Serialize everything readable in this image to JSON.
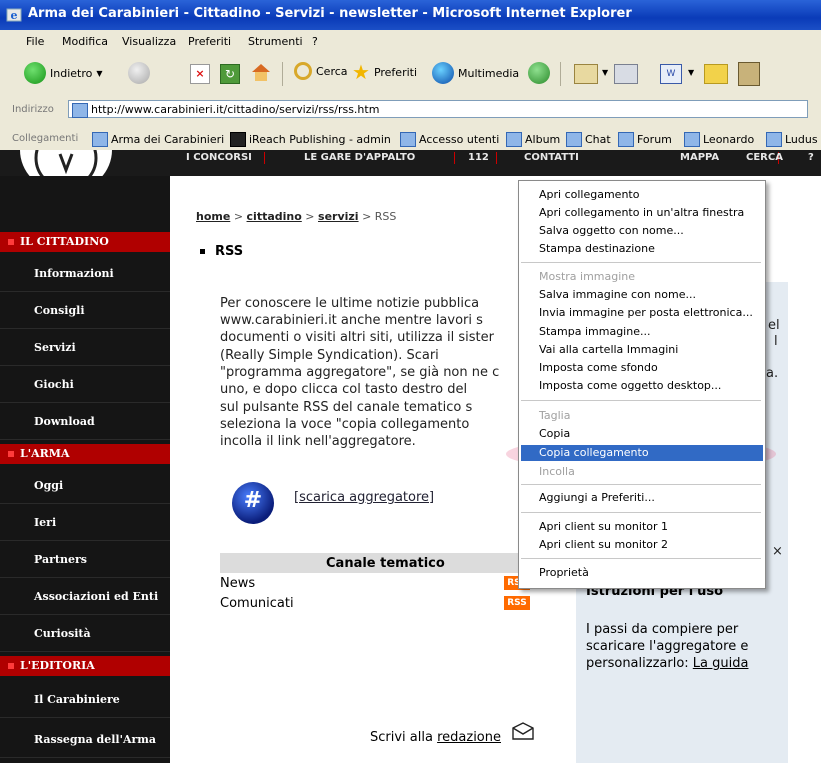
{
  "window": {
    "title": "Arma dei Carabinieri - Cittadino - Servizi - newsletter - Microsoft Internet Explorer"
  },
  "menubar": {
    "items": [
      "File",
      "Modifica",
      "Visualizza",
      "Preferiti",
      "Strumenti",
      "?"
    ]
  },
  "toolbar": {
    "back": "Indietro",
    "search": "Cerca",
    "favorites": "Preferiti",
    "media": "Multimedia"
  },
  "address": {
    "label": "Indirizzo",
    "url": "http://www.carabinieri.it/cittadino/servizi/rss/rss.htm"
  },
  "links": {
    "label": "Collegamenti",
    "items": [
      "Arma dei Carabinieri",
      "iReach Publishing - admin",
      "Accesso utenti",
      "Album",
      "Chat",
      "Forum",
      "Leonardo",
      "Ludus"
    ]
  },
  "topnav": {
    "items": [
      "I CONCORSI",
      "LE GARE D'APPALTO",
      "112",
      "CONTATTI",
      "MAPPA",
      "CERCA",
      "?"
    ]
  },
  "sidebar": {
    "sections": [
      "IL CITTADINO",
      "L'ARMA",
      "L'EDITORIA"
    ],
    "cittadino": [
      "Informazioni",
      "Consigli",
      "Servizi",
      "Giochi",
      "Download"
    ],
    "arma": [
      "Oggi",
      "Ieri",
      "Partners",
      "Associazioni ed Enti",
      "Curiosità"
    ],
    "editoria": [
      "Il Carabiniere",
      "Rassegna dell'Arma"
    ]
  },
  "breadcrumb": {
    "home": "home",
    "sep": ">",
    "cittadino": "cittadino",
    "servizi": "servizi",
    "current": "RSS"
  },
  "content": {
    "heading": "RSS",
    "lines": [
      "Per conoscere le ultime notizie pubblica",
      "www.carabinieri.it anche mentre lavori s",
      "documenti o visiti altri siti, utilizza il sister",
      "(Really    Simple    Syndication).    Scari",
      "\"programma aggregatore\", se già non ne c",
      "uno, e dopo clicca col tasto destro del",
      "sul pulsante RSS del canale tematico s",
      "seleziona  la  voce  \"copia  collegamento",
      "incolla il link nell'aggregatore."
    ],
    "aggregator_link": "[scarica aggregatore]",
    "table_header": "Canale tematico",
    "rows": [
      "News",
      "Comunicati"
    ],
    "rss_badge": "RSS",
    "partial_right": [
      "el",
      "l",
      "a.",
      "×"
    ]
  },
  "rightbox": {
    "title": "Istruzioni per l'uso",
    "lines": [
      "I passi da compiere per",
      "scaricare l'aggregatore e",
      "personalizzarlo: "
    ],
    "link": "La guida"
  },
  "footer": {
    "text": "Scrivi alla ",
    "link": "redazione"
  },
  "context_menu": {
    "group1": [
      "Apri collegamento",
      "Apri collegamento in un'altra finestra",
      "Salva oggetto con nome...",
      "Stampa destinazione"
    ],
    "group2": [
      "Mostra immagine",
      "Salva immagine con nome...",
      "Invia immagine per posta elettronica...",
      "Stampa immagine...",
      "Vai alla cartella Immagini",
      "Imposta come sfondo",
      "Imposta come oggetto desktop..."
    ],
    "group3": [
      "Taglia",
      "Copia",
      "Copia collegamento",
      "Incolla"
    ],
    "group4": [
      "Aggiungi a Preferiti..."
    ],
    "group5": [
      "Apri client su monitor 1",
      "Apri client su monitor 2"
    ],
    "group6": [
      "Proprietà"
    ]
  },
  "colors": {
    "titlebar": "#0a3bb8",
    "sidebar": "#151515",
    "section_red": "#b00000",
    "rss_orange": "#ff6a00",
    "menu_highlight": "#316ac5"
  }
}
